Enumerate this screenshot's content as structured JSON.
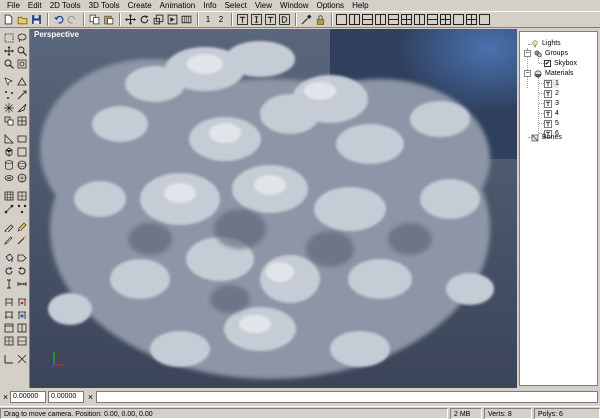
{
  "menu": {
    "items": [
      "File",
      "Edit",
      "2D Tools",
      "3D Tools",
      "Create",
      "Animation",
      "Info",
      "Select",
      "View",
      "Window",
      "Options",
      "Help"
    ]
  },
  "toolbar": {
    "frame_num_1": "1",
    "frame_num_2": "2"
  },
  "viewport": {
    "label": "Perspective",
    "sky_color": "#3f5f95",
    "cloud_color": "#c9cdd4"
  },
  "tree": {
    "lights": "Lights",
    "groups": "Groups",
    "skybox": "Skybox",
    "materials": "Materials",
    "material_items": [
      "1",
      "2",
      "3",
      "4",
      "5",
      "6"
    ],
    "bones": "Bones"
  },
  "inputbar": {
    "field_1": "0.00000",
    "field_2": "0.00000",
    "close_1": "×",
    "close_2": "×"
  },
  "status": {
    "message": "Drag to move camera. Position: 0.00, 0.00, 0.00",
    "memory": "2 MB",
    "verts": "Verts: 8",
    "polys": "Polys: 6"
  }
}
